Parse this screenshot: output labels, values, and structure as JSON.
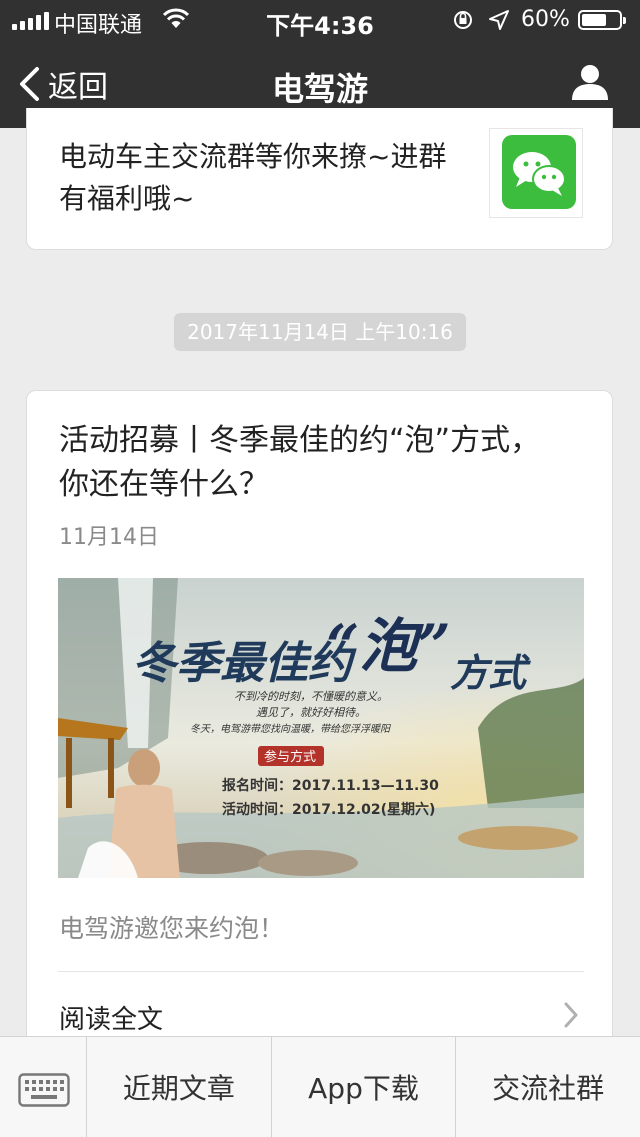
{
  "status_bar": {
    "carrier": "中国联通",
    "time": "下午4:36",
    "battery_percent": "60%",
    "battery_level": 0.6,
    "icons": [
      "signal-icon",
      "wifi-icon",
      "orientation-lock-icon",
      "location-icon",
      "battery-icon"
    ]
  },
  "nav": {
    "back_label": "返回",
    "title": "电驾游",
    "icons": [
      "chevron-left-icon",
      "user-profile-icon"
    ]
  },
  "previous_card": {
    "text": "电动车主交流群等你来撩~进群有福利哦~",
    "thumbnail_icon": "wechat-icon"
  },
  "timestamp": "2017年11月14日 上午10:16",
  "article": {
    "title": "活动招募丨冬季最佳的约“泡”方式，你还在等什么？",
    "date": "11月14日",
    "cover": {
      "headline_prefix": "冬季最佳约",
      "headline_highlight": "“泡”",
      "headline_suffix": "方式",
      "line1": "不到冷的时刻，不懂暖的意义。",
      "line2": "遇见了，就好好相待。",
      "line3": "冬天，电驾游带您找向温暖，带给您浮浮暖阳",
      "badge": "参与方式",
      "signup": "报名时间：2017.11.13—11.30",
      "event": "活动时间：2017.12.02(星期六)"
    },
    "description": "电驾游邀您来约泡！",
    "read_more": "阅读全文"
  },
  "bottom_menu": {
    "keyboard_icon": "keyboard-icon",
    "items": [
      {
        "label": "近期文章"
      },
      {
        "label": "App下载"
      },
      {
        "label": "交流社群"
      }
    ]
  },
  "colors": {
    "nav_bg": "#313131",
    "page_bg": "#ececec",
    "wechat_green": "#3dbd3d"
  }
}
